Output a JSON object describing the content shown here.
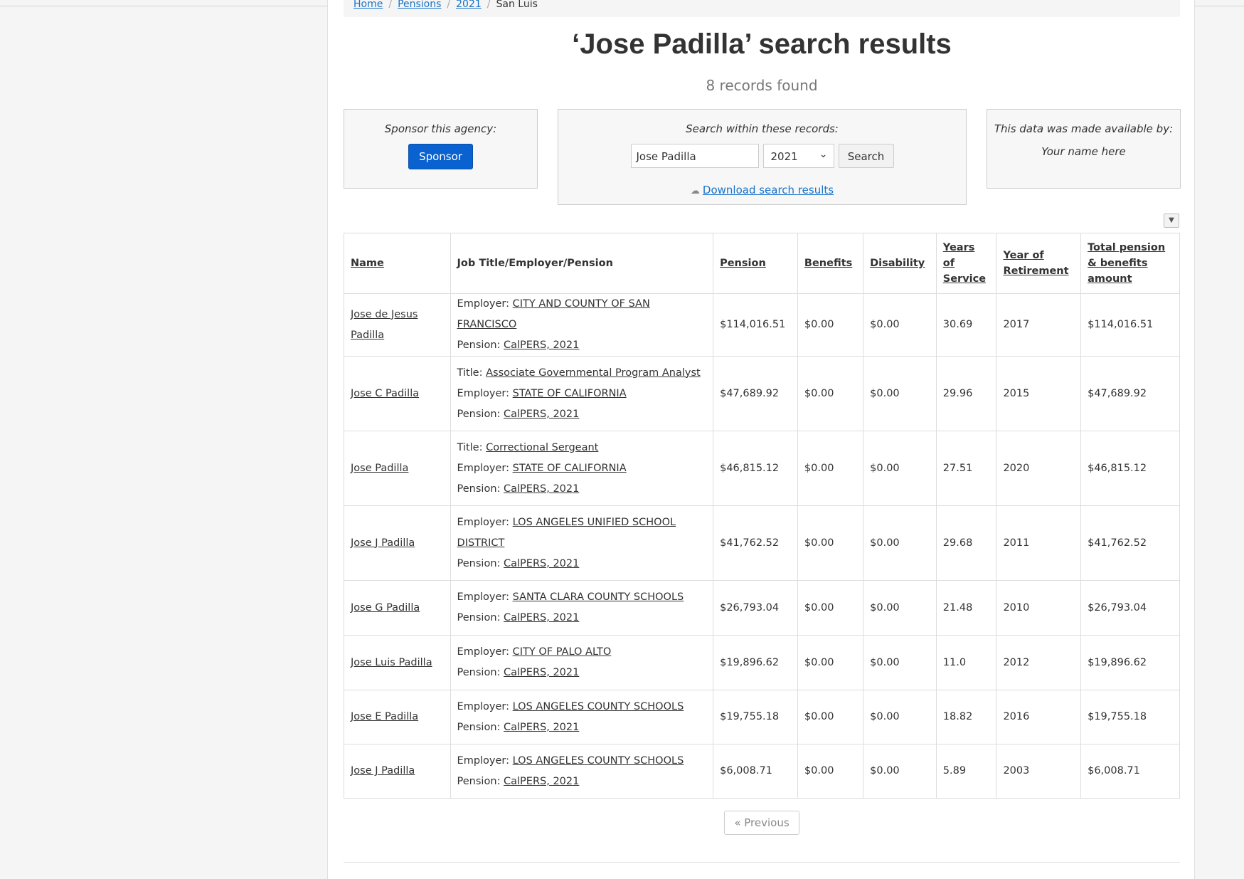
{
  "breadcrumb": [
    {
      "label": "Home"
    },
    {
      "label": "Pensions"
    },
    {
      "label": "2021"
    },
    {
      "label": "San Luis"
    }
  ],
  "title": "‘Jose Padilla’ search results",
  "subtitle": "8 records found",
  "sponsor_panel": {
    "label": "Sponsor this agency:",
    "button": "Sponsor"
  },
  "search_panel": {
    "label": "Search within these records:",
    "query": "Jose Padilla",
    "year": "2021",
    "button": "Search",
    "download": "Download search results"
  },
  "credit_panel": {
    "label": "This data was made available by:",
    "name": "Your name here"
  },
  "columns_toggle_icon": "caret-down-icon",
  "table": {
    "headers": [
      "Name",
      "Job Title/Employer/Pension",
      "Pension",
      "Benefits",
      "Disability",
      "Years of Service",
      "Year of Retirement",
      "Total pension & benefits amount"
    ],
    "rows": [
      {
        "name": "Jose de Jesus Padilla",
        "title": "",
        "employer": "CITY AND COUNTY OF SAN FRANCISCO",
        "pension_link": "CalPERS, 2021",
        "pension": "$114,016.51",
        "benefits": "$0.00",
        "disability": "$0.00",
        "years": "30.69",
        "retired": "2017",
        "total": "$114,016.51"
      },
      {
        "name": "Jose C Padilla",
        "title": "Associate Governmental Program Analyst",
        "employer": "STATE OF CALIFORNIA",
        "pension_link": "CalPERS, 2021",
        "pension": "$47,689.92",
        "benefits": "$0.00",
        "disability": "$0.00",
        "years": "29.96",
        "retired": "2015",
        "total": "$47,689.92"
      },
      {
        "name": "Jose Padilla",
        "title": "Correctional Sergeant",
        "employer": "STATE OF CALIFORNIA",
        "pension_link": "CalPERS, 2021",
        "pension": "$46,815.12",
        "benefits": "$0.00",
        "disability": "$0.00",
        "years": "27.51",
        "retired": "2020",
        "total": "$46,815.12"
      },
      {
        "name": "Jose J Padilla",
        "title": "",
        "employer": "LOS ANGELES UNIFIED SCHOOL DISTRICT",
        "pension_link": "CalPERS, 2021",
        "pension": "$41,762.52",
        "benefits": "$0.00",
        "disability": "$0.00",
        "years": "29.68",
        "retired": "2011",
        "total": "$41,762.52"
      },
      {
        "name": "Jose G Padilla",
        "title": "",
        "employer": "SANTA CLARA COUNTY SCHOOLS",
        "pension_link": "CalPERS, 2021",
        "pension": "$26,793.04",
        "benefits": "$0.00",
        "disability": "$0.00",
        "years": "21.48",
        "retired": "2010",
        "total": "$26,793.04"
      },
      {
        "name": "Jose Luis Padilla",
        "title": "",
        "employer": "CITY OF PALO ALTO",
        "pension_link": "CalPERS, 2021",
        "pension": "$19,896.62",
        "benefits": "$0.00",
        "disability": "$0.00",
        "years": "11.0",
        "retired": "2012",
        "total": "$19,896.62"
      },
      {
        "name": "Jose E Padilla",
        "title": "",
        "employer": "LOS ANGELES COUNTY SCHOOLS",
        "pension_link": "CalPERS, 2021",
        "pension": "$19,755.18",
        "benefits": "$0.00",
        "disability": "$0.00",
        "years": "18.82",
        "retired": "2016",
        "total": "$19,755.18"
      },
      {
        "name": "Jose J Padilla",
        "title": "",
        "employer": "LOS ANGELES COUNTY SCHOOLS",
        "pension_link": "CalPERS, 2021",
        "pension": "$6,008.71",
        "benefits": "$0.00",
        "disability": "$0.00",
        "years": "5.89",
        "retired": "2003",
        "total": "$6,008.71"
      }
    ]
  },
  "labels": {
    "title_prefix": "Title:",
    "employer_prefix": "Employer:",
    "pension_prefix": "Pension:"
  },
  "pagination": {
    "previous": "« Previous"
  }
}
